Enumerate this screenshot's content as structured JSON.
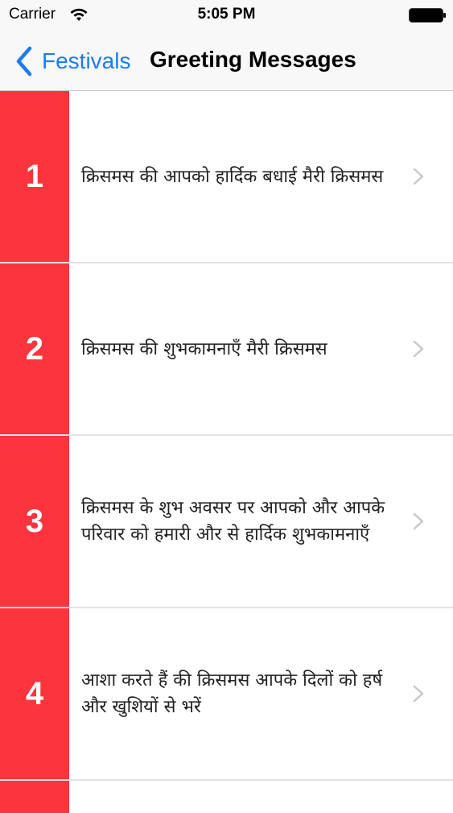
{
  "status_bar": {
    "carrier": "Carrier",
    "time": "5:05 PM",
    "wifi_icon": "wifi-icon",
    "battery_icon": "battery-icon"
  },
  "nav": {
    "back_label": "Festivals",
    "title": "Greeting Messages",
    "back_icon": "chevron-left-icon",
    "accent_color": "#1a7cf5"
  },
  "list": {
    "number_block_color": "#fc343d",
    "items": [
      {
        "number": "1",
        "text": "क्रिसमस की आपको हार्दिक बधाई मैरी क्रिसमस"
      },
      {
        "number": "2",
        "text": "क्रिसमस की शुभकामनाएँ मैरी  क्रिसमस"
      },
      {
        "number": "3",
        "text": "क्रिसमस के शुभ अवसर पर आपको और आपके परिवार को हमारी और से हार्दिक शुभकामनाएँ"
      },
      {
        "number": "4",
        "text": "आशा करते हैं की क्रिसमस आपके दिलों को हर्ष और खुशियों से भरें"
      }
    ]
  }
}
